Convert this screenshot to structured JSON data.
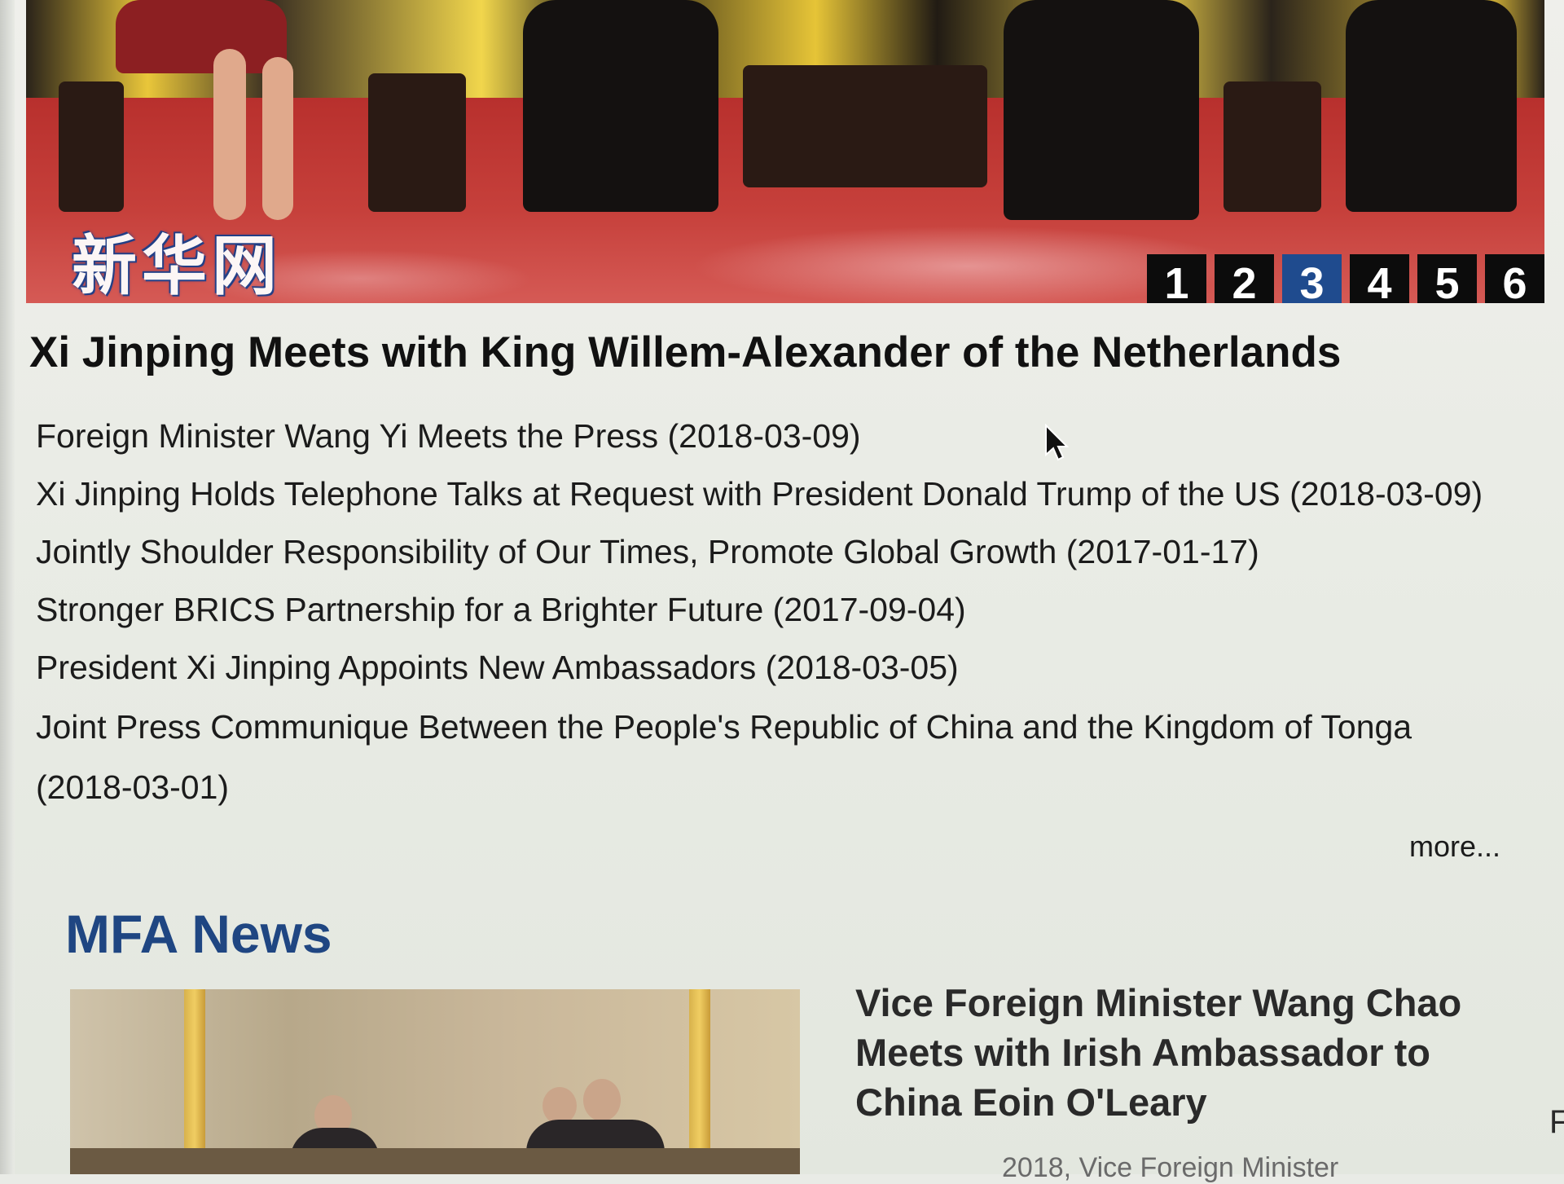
{
  "carousel": {
    "watermark": "新华网",
    "pages": [
      "1",
      "2",
      "3",
      "4",
      "5",
      "6"
    ],
    "active_page": "3"
  },
  "headline": "Xi Jinping Meets with King Willem-Alexander of the Netherlands",
  "news": [
    {
      "text": "Foreign Minister Wang Yi Meets the Press (2018-03-09)"
    },
    {
      "text": "Xi Jinping Holds Telephone Talks at Request with President Donald Trump of the US (2018-03-09)"
    },
    {
      "text": "Jointly Shoulder Responsibility of Our Times, Promote Global Growth (2017-01-17)"
    },
    {
      "text": "Stronger BRICS Partnership for a Brighter Future (2017-09-04)"
    },
    {
      "text": "President Xi Jinping Appoints New Ambassadors (2018-03-05)"
    },
    {
      "text": "Joint Press Communique Between the People's Republic of China and the Kingdom of Tonga (2018-03-01)"
    }
  ],
  "more_label": "more...",
  "mfa": {
    "section_title": "MFA News",
    "feature_title": "Vice Foreign Minister Wang Chao Meets with Irish Ambassador to China Eoin O'Leary",
    "feature_snippet": "2018, Vice Foreign Minister",
    "edge_text": "F"
  },
  "colors": {
    "accent_blue": "#1f4682",
    "pager_active": "#1f4b8e",
    "pager_bg": "#0c0c0c"
  }
}
